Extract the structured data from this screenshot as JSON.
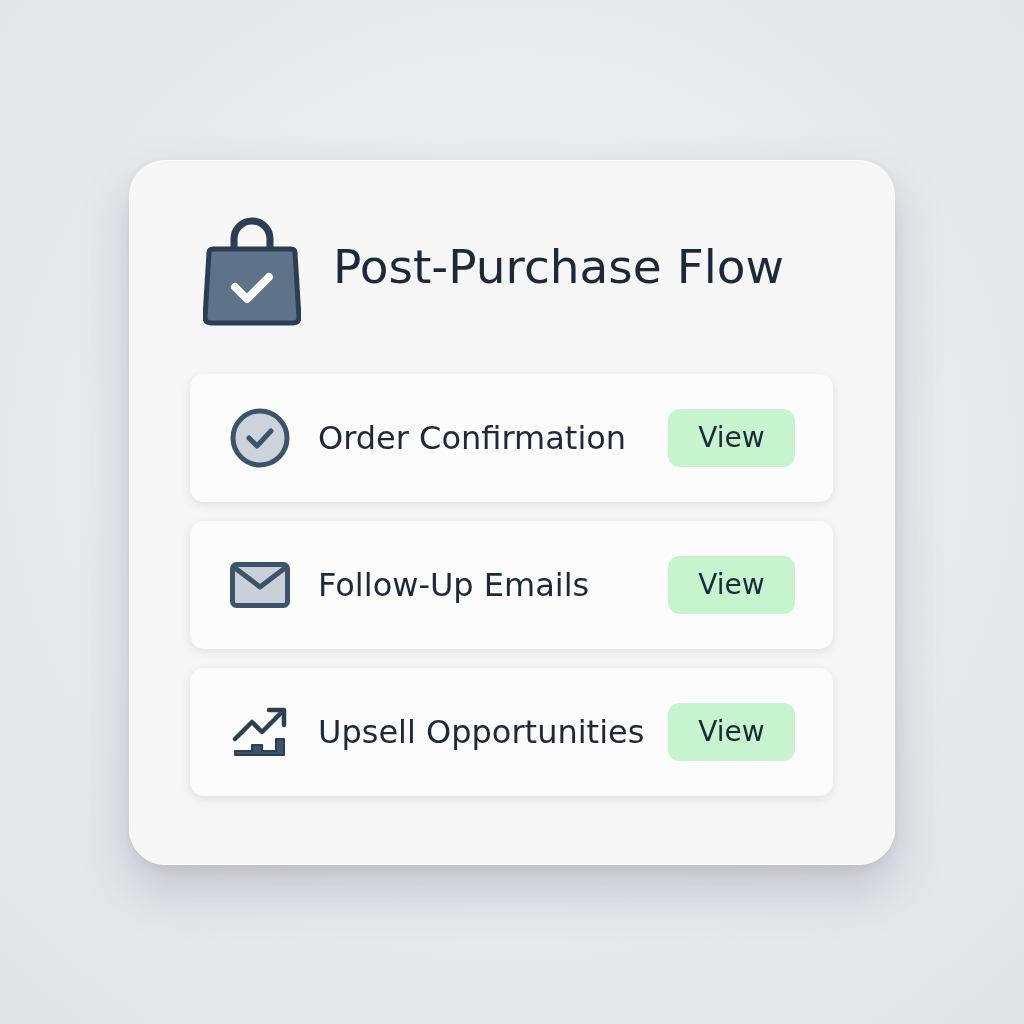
{
  "card": {
    "title": "Post-Purchase Flow"
  },
  "steps": [
    {
      "kind": "confirmation",
      "label": "Order Confirmation",
      "button": "View"
    },
    {
      "kind": "email",
      "label": "Follow-Up Emails",
      "button": "View"
    },
    {
      "kind": "growth",
      "label": "Upsell Opportunities",
      "button": "View"
    }
  ]
}
